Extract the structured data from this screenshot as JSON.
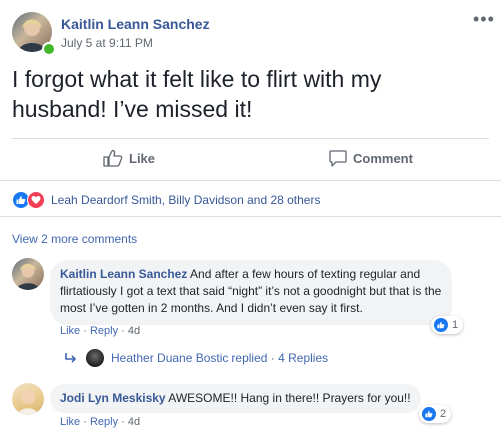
{
  "post": {
    "author": "Kaitlin Leann Sanchez",
    "timestamp": "July 5 at 9:11 PM",
    "more_icon": "more-dots-icon",
    "text": "I forgot what it felt like to flirt with my husband! I’ve missed it!"
  },
  "actions": {
    "like_label": "Like",
    "comment_label": "Comment"
  },
  "reactions": {
    "summary": "Leah Deardorf Smith, Billy Davidson and 28 others",
    "types": [
      "like",
      "love"
    ]
  },
  "comments": {
    "view_more": "View 2 more comments",
    "items": [
      {
        "author": "Kaitlin Leann Sanchez",
        "text": "And after a few hours of texting regular and flirtatiously I got a text that said “night” it’s not a goodnight but that is the most I’ve gotten in 2 months. And I didn’t even say it first.",
        "like": "Like",
        "reply": "Reply",
        "age": "4d",
        "reaction_count": "1",
        "replies": {
          "author": "Heather Duane Bostic",
          "replied": "replied",
          "count": "4 Replies"
        }
      },
      {
        "author": "Jodi Lyn Meskisky",
        "text": "AWESOME!! Hang in there!! Prayers for you!!",
        "like": "Like",
        "reply": "Reply",
        "age": "4d",
        "reaction_count": "2"
      }
    ]
  },
  "colors": {
    "link": "#385898",
    "accent": "#1877f2",
    "love": "#f33e58",
    "online": "#42b72a",
    "bubble": "#f2f3f5"
  }
}
